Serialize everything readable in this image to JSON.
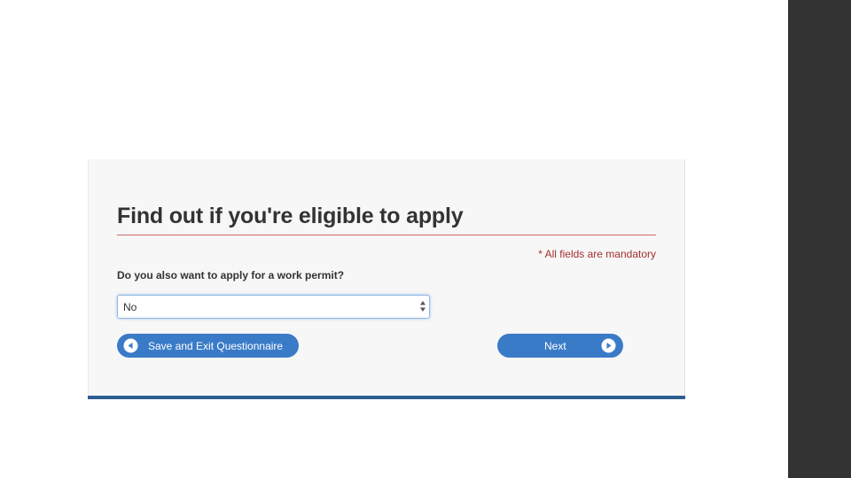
{
  "form": {
    "title": "Find out if you're eligible to apply",
    "mandatory_note": "* All fields are mandatory",
    "question": "Do you also want to apply for a work permit?",
    "select": {
      "selected_value": "No"
    }
  },
  "buttons": {
    "save_exit_label": "Save and Exit Questionnaire",
    "save_exit_icon": "circle-arrow-left-icon",
    "next_label": "Next",
    "next_icon": "circle-arrow-right-icon"
  },
  "colors": {
    "button_blue": "#3a7bc8",
    "mandatory_red": "#a3302d",
    "panel_bottom_bar": "#2d5f93",
    "right_sidebar": "#333333"
  }
}
